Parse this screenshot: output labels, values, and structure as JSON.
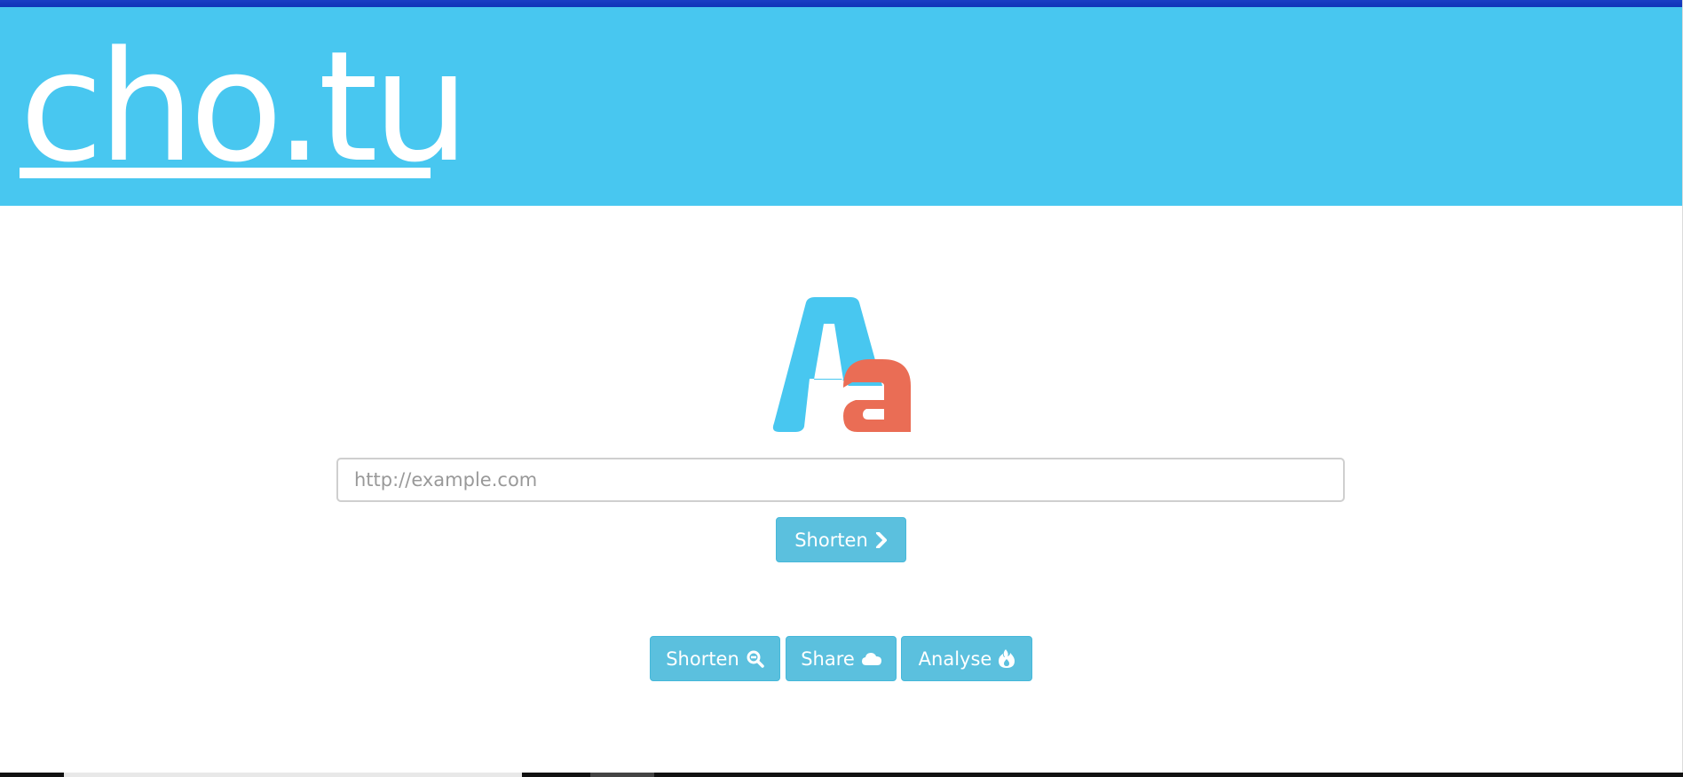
{
  "header": {
    "brand": "cho.tu"
  },
  "logo": {
    "name": "Aa logo",
    "colors": {
      "blue": "#48c7f0",
      "orange": "#ea6d55"
    }
  },
  "form": {
    "url_placeholder": "http://example.com",
    "url_value": "",
    "submit_label": "Shorten"
  },
  "features": [
    {
      "label": "Shorten",
      "icon": "search-minus-icon"
    },
    {
      "label": "Share",
      "icon": "cloud-icon"
    },
    {
      "label": "Analyse",
      "icon": "fire-icon"
    }
  ],
  "colors": {
    "header_bg": "#48c7f0",
    "button_bg": "#5bc0de",
    "button_border": "#46b8da"
  }
}
